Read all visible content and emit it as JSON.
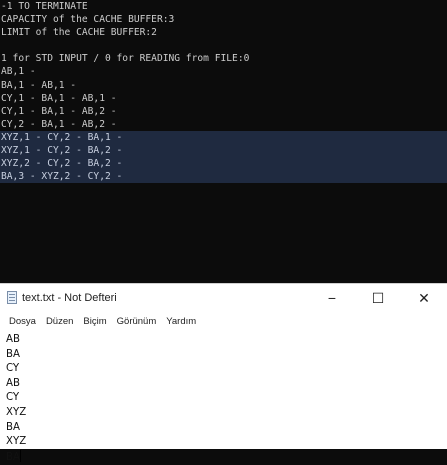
{
  "console": {
    "lines": [
      "-1 TO TERMINATE",
      "CAPACITY of the CACHE BUFFER:3",
      "LIMIT of the CACHE BUFFER:2",
      "",
      "1 for STD INPUT / 0 for READING from FILE:0",
      "AB,1 -",
      "BA,1 - AB,1 -",
      "CY,1 - BA,1 - AB,1 -",
      "CY,1 - BA,1 - AB,2 -",
      "CY,2 - BA,1 - AB,2 -",
      "XYZ,1 - CY,2 - BA,1 -",
      "XYZ,1 - CY,2 - BA,2 -",
      "XYZ,2 - CY,2 - BA,2 -",
      "BA,3 - XYZ,2 - CY,2 -"
    ]
  },
  "notepad": {
    "title": "text.txt - Not Defteri",
    "controls": {
      "minimize": "−",
      "maximize": "☐",
      "close": "✕"
    },
    "menu": [
      "Dosya",
      "Düzen",
      "Biçim",
      "Görünüm",
      "Yardım"
    ],
    "lines": [
      "AB",
      "BA",
      "CY",
      "AB",
      "CY",
      "XYZ",
      "BA",
      "XYZ"
    ],
    "last_line": "BA"
  }
}
